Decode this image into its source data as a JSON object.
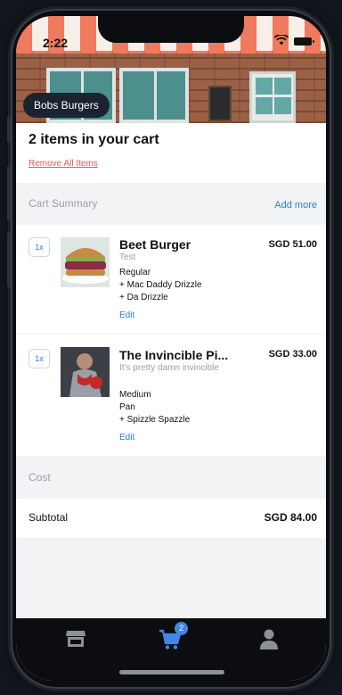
{
  "status_bar": {
    "time": "2:22"
  },
  "store": {
    "name": "Bobs Burgers"
  },
  "cart": {
    "title": "2 items in your cart",
    "remove_all_label": "Remove All Items"
  },
  "summary": {
    "label": "Cart Summary",
    "add_more_label": "Add more"
  },
  "items": [
    {
      "qty": "1x",
      "name": "Beet Burger",
      "description": "Test",
      "price": "SGD 51.00",
      "options": [
        "Regular",
        "+ Mac Daddy Drizzle",
        "+ Da Drizzle"
      ],
      "edit_label": "Edit"
    },
    {
      "qty": "1x",
      "name": "The Invincible Pi...",
      "description": "It's pretty damn invincible",
      "price": "SGD 33.00",
      "options": [
        "Medium",
        "Pan",
        "+ Spizzle Spazzle"
      ],
      "edit_label": "Edit"
    }
  ],
  "cost": {
    "label": "Cost",
    "subtotal_label": "Subtotal",
    "subtotal_value": "SGD 84.00"
  },
  "tabbar": {
    "cart_badge": "2"
  },
  "colors": {
    "accent": "#2e7bd6",
    "danger": "#e5575e",
    "badge": "#3f86e8"
  }
}
